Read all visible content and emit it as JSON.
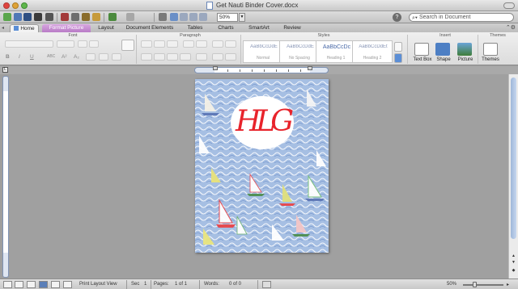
{
  "window": {
    "title": "Get Nauti Binder Cover.docx"
  },
  "toolbar": {
    "zoom_value": "50%",
    "search_placeholder": "Search in Document"
  },
  "ribbon_tabs": [
    {
      "label": "Home"
    },
    {
      "label": "Format Picture"
    },
    {
      "label": "Layout"
    },
    {
      "label": "Document Elements"
    },
    {
      "label": "Tables"
    },
    {
      "label": "Charts"
    },
    {
      "label": "SmartArt"
    },
    {
      "label": "Review"
    }
  ],
  "ribbon": {
    "groups": {
      "font": "Font",
      "paragraph": "Paragraph",
      "styles": "Styles",
      "insert": "Insert",
      "themes": "Themes"
    },
    "styles": [
      {
        "sample": "AaBbCcDdE",
        "name": "Normal"
      },
      {
        "sample": "AaBbCcDdE",
        "name": "No Spacing"
      },
      {
        "sample": "AaBbCcDc",
        "name": "Heading 1"
      },
      {
        "sample": "AaBbCcDdEt",
        "name": "Heading 2"
      }
    ],
    "insert_buttons": [
      {
        "label": "Text Box"
      },
      {
        "label": "Shape"
      },
      {
        "label": "Picture"
      }
    ],
    "themes_button": "Themes"
  },
  "document": {
    "monogram": "HLG"
  },
  "status": {
    "view_name": "Print Layout View",
    "sec_label": "Sec",
    "sec_value": "1",
    "pages_label": "Pages:",
    "pages_value": "1 of 1",
    "words_label": "Words:",
    "words_value": "0 of 0",
    "zoom_value": "50%"
  },
  "colors": {
    "accent_tab": "#b87cc6",
    "monogram": "#e8232b",
    "pattern_bg": "#9ab4dc"
  }
}
